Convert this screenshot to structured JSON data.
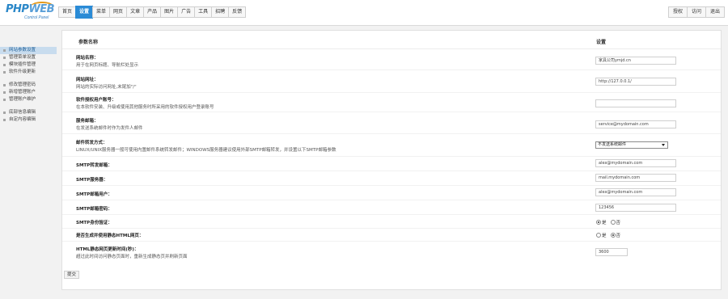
{
  "logo": {
    "main_a": "PHP",
    "main_b": "WEB",
    "sub": "Control Panel"
  },
  "nav": [
    "首页",
    "设置",
    "菜单",
    "网页",
    "文章",
    "产品",
    "图片",
    "广告",
    "工具",
    "招聘",
    "反馈"
  ],
  "nav_active_index": 1,
  "topright": [
    "授权",
    "访问",
    "退出"
  ],
  "sidebar": {
    "groups": [
      [
        "网站参数设置",
        "管理菜单设置",
        "模块插件管理",
        "软件升级更新"
      ],
      [
        "修改管理密码",
        "新增管理账户",
        "管理账户维护"
      ],
      [
        "底部信息编辑",
        "自定内容编辑"
      ]
    ],
    "active": "网站参数设置"
  },
  "table": {
    "col_param": "参数名称",
    "col_setting": "设置"
  },
  "rows": {
    "site_name": {
      "label": "网站名称：",
      "desc": "用于在网页标题、导航栏处显示",
      "value": "家具公司ymjd.cn"
    },
    "site_url": {
      "label": "网站网址：",
      "desc": "网站的实际访问网址,末尾加\"/\"",
      "value": "http://127.0.0.1/"
    },
    "license": {
      "label": "软件授权用户账号：",
      "desc": "在本软件安装、升级或使用其他服务时所采用的软件授权用户登录账号",
      "value": ""
    },
    "email": {
      "label": "服务邮箱：",
      "desc": "在发送系统邮件时作为发件人邮件",
      "value": "service@mydomain.com"
    },
    "mail_mode": {
      "label": "邮件转发方式：",
      "desc": "LINUX/UNIX服务器一般可使用内置邮件系统转发邮件；WINDOWS服务器建议使用外部SMTP邮箱转发，并设置以下SMTP邮箱参数",
      "value": "不发送系统邮件"
    },
    "smtp_sender": {
      "label": "SMTP转发邮箱：",
      "value": "alex@mydomain.com"
    },
    "smtp_server": {
      "label": "SMTP服务器：",
      "value": "mail.mydomain.com"
    },
    "smtp_user": {
      "label": "SMTP邮箱用户：",
      "value": "alex@mydomain.com"
    },
    "smtp_pass": {
      "label": "SMTP邮箱密码：",
      "value": "123456"
    },
    "smtp_auth": {
      "label": "SMTP身份验证：",
      "yes": "是",
      "no": "否",
      "selected": "yes"
    },
    "static_html": {
      "label": "是否生成并使用静态HTML网页：",
      "yes": "是",
      "no": "否",
      "selected": "no"
    },
    "refresh": {
      "label": "HTML静态网页更新时间(秒)：",
      "desc": "超过此时间访问静态页面时，重新生成静态页并刷新页面",
      "value": "3600"
    }
  },
  "submit_label": "提交"
}
